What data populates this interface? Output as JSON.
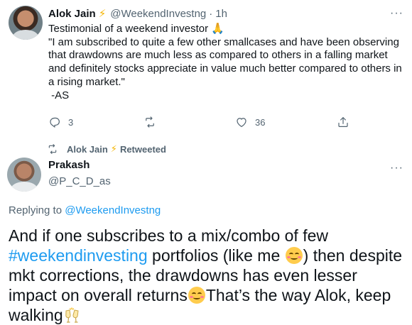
{
  "tweet1": {
    "author_name": "Alok Jain",
    "author_badge_icon": "lightning-bolt",
    "handle": "@WeekendInvestng",
    "separator": "·",
    "time": "1h",
    "more_icon": "more-horizontal",
    "text_lines": [
      "Testimonial of a weekend investor 🙏",
      "\"I am subscribed to quite a few other smallcases and have been observing",
      "that drawdowns are much less as compared to others in a falling market",
      "and definitely stocks appreciate in value much better compared to others in",
      "a rising market.\"",
      " -AS"
    ],
    "actions": {
      "reply_count": "3",
      "retweet_count": "",
      "like_count": "36"
    }
  },
  "retweet_line": {
    "name": "Alok Jain",
    "label": "Retweeted"
  },
  "tweet2": {
    "author_name": "Prakash",
    "handle": "@P_C_D_as",
    "replying_prefix": "Replying to",
    "replying_to": "@WeekendInvestng",
    "text": {
      "line1": "And if one subscribes to a mix/combo of few",
      "hashtag": "#weekendinvesting",
      "line2_mid": " portfolios (like me ",
      "line2_end": ") then despite",
      "line3": "mkt corrections, the drawdowns has even lesser",
      "line4_a": "impact on overall returns",
      "line4_b": "That’s the way Alok, keep",
      "line5": "walking"
    }
  },
  "colors": {
    "text": "#0f1419",
    "secondary": "#536471",
    "link": "#1d9bf0",
    "badge": "#f4b400"
  }
}
